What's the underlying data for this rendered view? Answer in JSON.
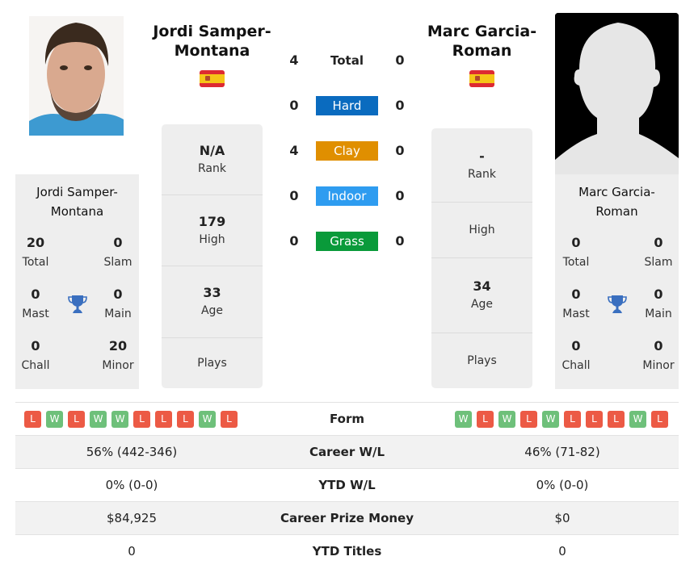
{
  "colors": {
    "hard": "#0a6bbf",
    "clay": "#e08f00",
    "indoor": "#2e9cf0",
    "grass": "#0a9a3a",
    "win": "#6ec07a",
    "loss": "#ec5a45",
    "trophy": "#3a6fbf"
  },
  "player1": {
    "name": "Jordi Samper-Montana",
    "name_line1": "Jordi Samper-",
    "name_line2": "Montana",
    "flag_icon": "spain-flag-icon",
    "rank": {
      "value": "N/A",
      "label": "Rank"
    },
    "high": {
      "value": "179",
      "label": "High"
    },
    "age": {
      "value": "33",
      "label": "Age"
    },
    "plays": {
      "value": "",
      "label": "Plays"
    },
    "titles": {
      "total": {
        "value": "20",
        "label": "Total"
      },
      "slam": {
        "value": "0",
        "label": "Slam"
      },
      "mast": {
        "value": "0",
        "label": "Mast"
      },
      "main": {
        "value": "0",
        "label": "Main"
      },
      "chall": {
        "value": "0",
        "label": "Chall"
      },
      "minor": {
        "value": "20",
        "label": "Minor"
      }
    },
    "form": [
      "L",
      "W",
      "L",
      "W",
      "W",
      "L",
      "L",
      "L",
      "W",
      "L"
    ],
    "career_wl": "56% (442-346)",
    "ytd_wl": "0% (0-0)",
    "prize_money": "$84,925",
    "ytd_titles": "0"
  },
  "player2": {
    "name": "Marc Garcia-Roman",
    "name_line1": "Marc Garcia-",
    "name_line2": "Roman",
    "flag_icon": "spain-flag-icon",
    "rank": {
      "value": "-",
      "label": "Rank"
    },
    "high": {
      "value": "",
      "label": "High"
    },
    "age": {
      "value": "34",
      "label": "Age"
    },
    "plays": {
      "value": "",
      "label": "Plays"
    },
    "titles": {
      "total": {
        "value": "0",
        "label": "Total"
      },
      "slam": {
        "value": "0",
        "label": "Slam"
      },
      "mast": {
        "value": "0",
        "label": "Mast"
      },
      "main": {
        "value": "0",
        "label": "Main"
      },
      "chall": {
        "value": "0",
        "label": "Chall"
      },
      "minor": {
        "value": "0",
        "label": "Minor"
      }
    },
    "form": [
      "W",
      "L",
      "W",
      "L",
      "W",
      "L",
      "L",
      "L",
      "W",
      "L"
    ],
    "career_wl": "46% (71-82)",
    "ytd_wl": "0% (0-0)",
    "prize_money": "$0",
    "ytd_titles": "0"
  },
  "h2h": [
    {
      "label": "Total",
      "p1": "4",
      "p2": "0",
      "key": "total"
    },
    {
      "label": "Hard",
      "p1": "0",
      "p2": "0",
      "key": "hard"
    },
    {
      "label": "Clay",
      "p1": "4",
      "p2": "0",
      "key": "clay"
    },
    {
      "label": "Indoor",
      "p1": "0",
      "p2": "0",
      "key": "indoor"
    },
    {
      "label": "Grass",
      "p1": "0",
      "p2": "0",
      "key": "grass"
    }
  ],
  "table": {
    "form_label": "Form",
    "career_wl_label": "Career W/L",
    "ytd_wl_label": "YTD W/L",
    "prize_label": "Career Prize Money",
    "ytd_titles_label": "YTD Titles"
  }
}
